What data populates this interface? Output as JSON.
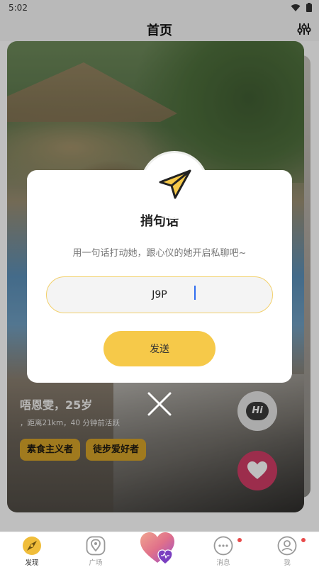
{
  "status": {
    "time": "5:02"
  },
  "header": {
    "title": "首页"
  },
  "profile": {
    "name_age": "唔恩雯，25岁",
    "meta": "，距离21km，40 分钟前活跃",
    "tags": [
      "素食主义者",
      "徒步爱好者"
    ],
    "hi_label": "Hi"
  },
  "modal": {
    "title": "捎句话",
    "description": "用一句话打动她，跟心仪的她开启私聊吧~",
    "input_value": "J9P",
    "send_label": "发送"
  },
  "tabs": [
    {
      "label": "发现",
      "icon": "discover-icon",
      "active": true,
      "badge": false
    },
    {
      "label": "广场",
      "icon": "square-icon",
      "active": false,
      "badge": false
    },
    {
      "label": "",
      "icon": "match-heart-icon",
      "active": false,
      "badge": false
    },
    {
      "label": "消息",
      "icon": "message-icon",
      "active": false,
      "badge": true
    },
    {
      "label": "我",
      "icon": "profile-icon",
      "active": false,
      "badge": true
    }
  ],
  "colors": {
    "accent": "#f6c949",
    "tag": "#d6a329",
    "like": "#d13c66",
    "badge": "#e84a4a"
  }
}
